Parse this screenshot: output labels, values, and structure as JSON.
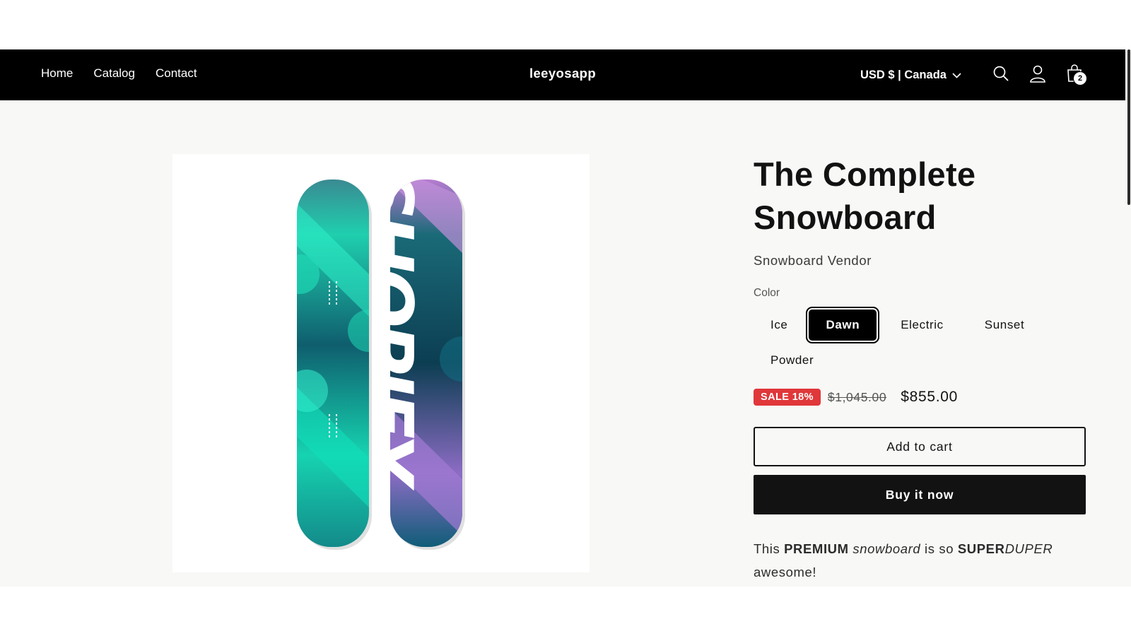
{
  "header": {
    "nav": [
      "Home",
      "Catalog",
      "Contact"
    ],
    "brand": "leeyosapp",
    "currency": "USD $ | Canada",
    "cart_count": "2",
    "icons": [
      "chevron-down-icon",
      "search-icon",
      "account-icon",
      "cart-icon"
    ]
  },
  "product": {
    "title_line1": "The Complete",
    "title_line2": "Snowboard",
    "vendor": "Snowboard Vendor",
    "option_label": "Color",
    "colors": [
      "Ice",
      "Dawn",
      "Electric",
      "Sunset",
      "Powder"
    ],
    "selected_color": "Dawn",
    "sale_badge": "SALE 18%",
    "compare_price": "$1,045.00",
    "price": "$855.00",
    "add_to_cart": "Add to cart",
    "buy_now": "Buy it now",
    "description": {
      "w1": "This ",
      "w2": "PREMIUM",
      "w3": " ",
      "w4": "snowboard",
      "w5": " is so ",
      "w6": "SUPER",
      "w7": "DUPER",
      "w8": " awesome!"
    },
    "image_text": "SHOPIFY"
  },
  "colors": {
    "header_bg": "#000000",
    "page_bg": "#f8f8f6",
    "sale_badge": "#e0373a",
    "board_left": "#19c9a8",
    "board_right": "#0d5a6b",
    "board_accent": "#b889d6"
  }
}
